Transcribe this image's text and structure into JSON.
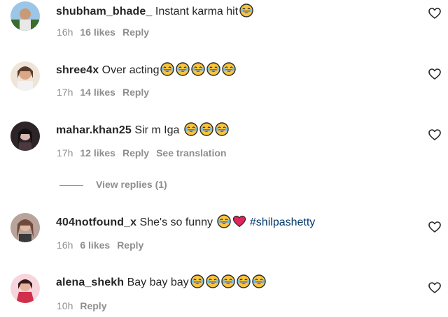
{
  "comments": [
    {
      "username": "shubham_bhade_",
      "text": "Instant karma hit",
      "emojis": [
        "joy-emoji"
      ],
      "time": "16h",
      "likes": "16 likes",
      "reply": "Reply",
      "avatar_colors": [
        "#9cc6e8",
        "#3b6b2e"
      ]
    },
    {
      "username": "shree4x",
      "text": "Over acting",
      "emojis": [
        "joy-emoji",
        "joy-emoji",
        "joy-emoji",
        "joy-emoji",
        "joy-emoji"
      ],
      "time": "17h",
      "likes": "14 likes",
      "reply": "Reply",
      "avatar_colors": [
        "#efe4d8",
        "#c98e6b"
      ]
    },
    {
      "username": "mahar.khan25",
      "text": "Sir m Iga",
      "emojis": [
        "joy-emoji",
        "joy-emoji",
        "joy-emoji"
      ],
      "time": "17h",
      "likes": "12 likes",
      "reply": "Reply",
      "translation": "See translation",
      "avatar_colors": [
        "#2c2426",
        "#d8b8b0"
      ]
    },
    {
      "username": "404notfound_x",
      "text": "She's so funny",
      "emojis": [
        "joy-emoji",
        "red-heart-emoji"
      ],
      "hashtag": "#shilpashetty",
      "time": "16h",
      "likes": "6 likes",
      "reply": "Reply",
      "avatar_colors": [
        "#b9a39a",
        "#6e4a3c"
      ]
    },
    {
      "username": "alena_shekh",
      "text": "Bay bay bay",
      "emojis": [
        "joy-emoji",
        "joy-emoji",
        "joy-emoji",
        "joy-emoji",
        "joy-emoji"
      ],
      "time": "10h",
      "reply": "Reply",
      "avatar_colors": [
        "#f6d6dc",
        "#d0304a"
      ]
    }
  ],
  "view_replies": "View replies (1)",
  "icons": {
    "like": "heart-outline-icon"
  },
  "colors": {
    "text": "#262626",
    "secondary": "#8e8e8e",
    "hashtag": "#00376b",
    "emoji_face": "#f8c43c",
    "heart": "#e0245e"
  }
}
